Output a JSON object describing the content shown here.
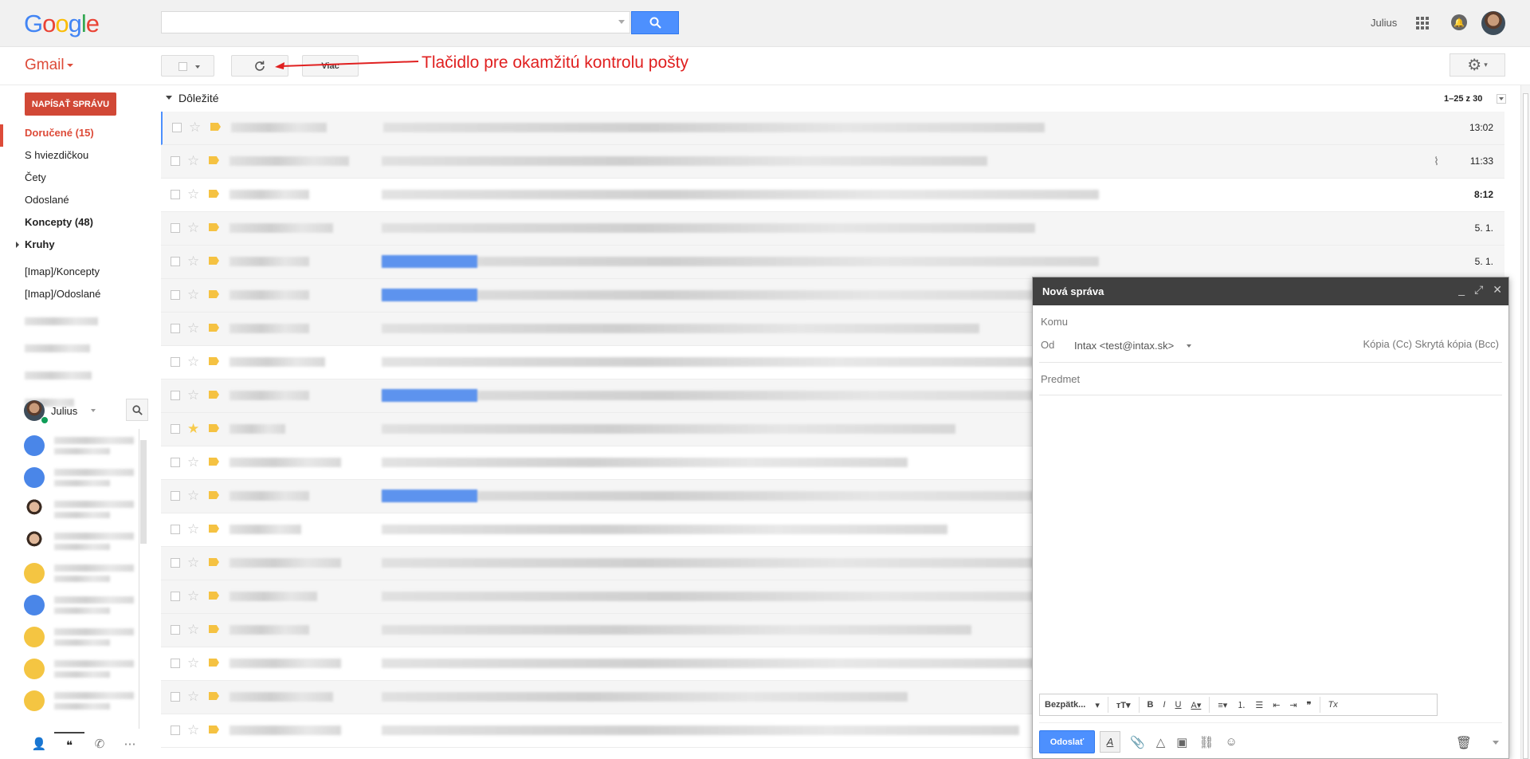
{
  "header": {
    "logo_text": "Google",
    "user_name": "Julius",
    "search_value": "",
    "search_icon": "magnifier-icon",
    "apps_icon": "apps-grid-icon",
    "notifications_icon": "bell-icon"
  },
  "app": {
    "label": "Gmail"
  },
  "toolbar": {
    "more_label": "Viac",
    "refresh_icon": "refresh-icon",
    "settings_icon": "gear-icon"
  },
  "annotation": {
    "text": "Tlačidlo pre okamžitú kontrolu pošty",
    "color": "#e02020"
  },
  "compose_button": "NAPÍSAŤ SPRÁVU",
  "nav": {
    "items": [
      {
        "label": "Doručené (15)",
        "state": "active"
      },
      {
        "label": "S hviezdičkou",
        "state": ""
      },
      {
        "label": "Čety",
        "state": ""
      },
      {
        "label": "Odoslané",
        "state": ""
      },
      {
        "label": "Koncepty (48)",
        "state": "bold"
      },
      {
        "label": "Kruhy",
        "state": "bold"
      },
      {
        "label": "[Imap]/Koncepty",
        "state": ""
      },
      {
        "label": "[Imap]/Odoslané",
        "state": ""
      }
    ]
  },
  "hangouts": {
    "user": "Julius",
    "tabs": [
      "person-icon",
      "hangouts-icon",
      "phone-icon",
      "more-icon"
    ]
  },
  "inbox": {
    "section": "Dôležité",
    "pager": "1–25 z 30",
    "rows": [
      {
        "time": "13:02",
        "unread": false,
        "starred": false,
        "attachment": false,
        "highlight": false
      },
      {
        "time": "11:33",
        "unread": false,
        "starred": false,
        "attachment": true,
        "highlight": false
      },
      {
        "time": "8:12",
        "unread": true,
        "starred": false,
        "attachment": false,
        "highlight": false
      },
      {
        "time": "5. 1.",
        "unread": false,
        "starred": false,
        "attachment": false,
        "highlight": false
      },
      {
        "time": "5. 1.",
        "unread": false,
        "starred": false,
        "attachment": false,
        "highlight": true
      },
      {
        "time": "",
        "unread": false,
        "starred": false,
        "attachment": false,
        "highlight": true
      },
      {
        "time": "",
        "unread": false,
        "starred": false,
        "attachment": false,
        "highlight": false
      },
      {
        "time": "",
        "unread": true,
        "starred": false,
        "attachment": false,
        "highlight": false
      },
      {
        "time": "",
        "unread": false,
        "starred": false,
        "attachment": false,
        "highlight": true
      },
      {
        "time": "",
        "unread": false,
        "starred": true,
        "attachment": false,
        "highlight": false
      },
      {
        "time": "",
        "unread": true,
        "starred": false,
        "attachment": false,
        "highlight": false
      },
      {
        "time": "",
        "unread": false,
        "starred": false,
        "attachment": false,
        "highlight": true
      },
      {
        "time": "",
        "unread": true,
        "starred": false,
        "attachment": false,
        "highlight": false
      },
      {
        "time": "",
        "unread": false,
        "starred": false,
        "attachment": false,
        "highlight": false
      },
      {
        "time": "",
        "unread": false,
        "starred": false,
        "attachment": false,
        "highlight": false
      },
      {
        "time": "",
        "unread": false,
        "starred": false,
        "attachment": false,
        "highlight": false
      },
      {
        "time": "",
        "unread": true,
        "starred": false,
        "attachment": false,
        "highlight": false
      },
      {
        "time": "",
        "unread": false,
        "starred": false,
        "attachment": false,
        "highlight": false
      },
      {
        "time": "",
        "unread": true,
        "starred": false,
        "attachment": false,
        "highlight": false
      }
    ]
  },
  "compose": {
    "title": "Nová správa",
    "to_label": "Komu",
    "from_label": "Od",
    "from_value": "Intax <test@intax.sk>",
    "cc_bcc": "Kópia (Cc)  Skrytá kópia (Bcc)",
    "subject_label": "Predmet",
    "font": "Bezpätk...",
    "send_label": "Odoslať"
  }
}
